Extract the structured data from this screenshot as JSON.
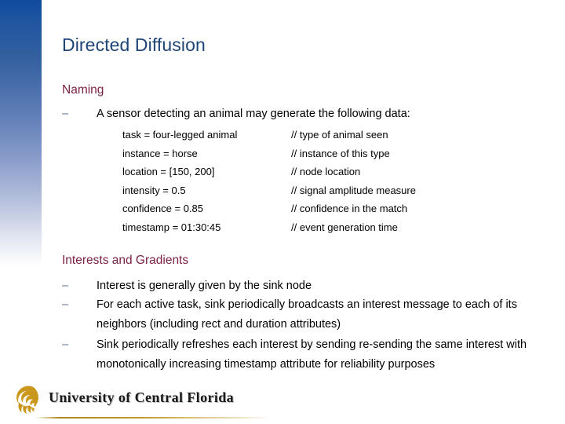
{
  "slide": {
    "title": "Directed Diffusion",
    "sections": [
      {
        "heading": "Naming",
        "bullets": [
          {
            "dash": "–",
            "text": "A sensor detecting an animal may generate the following data:"
          }
        ],
        "attribute_table": {
          "rows": [
            {
              "attribute": "task = four-legged animal",
              "comment": "// type of animal seen"
            },
            {
              "attribute": "instance = horse",
              "comment": "// instance of this type"
            },
            {
              "attribute": "location = [150, 200]",
              "comment": "// node location"
            },
            {
              "attribute": "intensity = 0.5",
              "comment": "// signal amplitude measure"
            },
            {
              "attribute": "confidence = 0.85",
              "comment": "// confidence in the match"
            },
            {
              "attribute": "timestamp = 01:30:45",
              "comment": "// event generation time"
            }
          ]
        }
      },
      {
        "heading": "Interests and Gradients",
        "bullets": [
          {
            "dash": "–",
            "text": "Interest is generally given by the sink node"
          },
          {
            "dash": "–",
            "text": "For each active task, sink periodically broadcasts an interest message to each of its neighbors (including rect and duration attributes)"
          },
          {
            "dash": "–",
            "text": "Sink periodically refreshes each interest by sending re-sending the same interest with monotonically increasing timestamp attribute for reliability purposes"
          }
        ]
      }
    ]
  },
  "footer": {
    "organization": "University of Central Florida",
    "logo_icon": "ucf-pegasus-logo-icon"
  },
  "colors": {
    "title": "#1f4477",
    "section_heading": "#7b2144",
    "body_text": "#000000",
    "bullet_dash": "#5b6c90",
    "band_top": "#0f4a9c",
    "logo_gold": "#c9971b",
    "rule_gold": "#b08a1e"
  }
}
